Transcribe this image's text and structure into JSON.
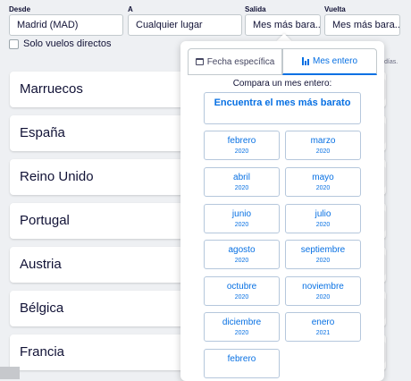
{
  "search": {
    "from_label": "Desde",
    "from_value": "Madrid (MAD)",
    "to_label": "A",
    "to_value": "Cualquier lugar",
    "depart_label": "Salida",
    "depart_value": "Mes más bara...",
    "return_label": "Vuelta",
    "return_value": "Mes más bara...",
    "direct_only_label": "Solo vuelos directos",
    "direct_only_checked": false
  },
  "side_note": "días.",
  "countries": [
    "Marruecos",
    "España",
    "Reino Unido",
    "Portugal",
    "Austria",
    "Bélgica",
    "Francia"
  ],
  "popup": {
    "tabs": [
      {
        "label": "Fecha específica",
        "icon": "calendar-icon",
        "active": false
      },
      {
        "label": "Mes entero",
        "icon": "bar-chart-icon",
        "active": true
      }
    ],
    "compare_text": "Compara un mes entero:",
    "cheapest_button": "Encuentra el mes más barato",
    "months": [
      {
        "name": "febrero",
        "year": "2020"
      },
      {
        "name": "marzo",
        "year": "2020"
      },
      {
        "name": "abril",
        "year": "2020"
      },
      {
        "name": "mayo",
        "year": "2020"
      },
      {
        "name": "junio",
        "year": "2020"
      },
      {
        "name": "julio",
        "year": "2020"
      },
      {
        "name": "agosto",
        "year": "2020"
      },
      {
        "name": "septiembre",
        "year": "2020"
      },
      {
        "name": "octubre",
        "year": "2020"
      },
      {
        "name": "noviembre",
        "year": "2020"
      },
      {
        "name": "diciembre",
        "year": "2020"
      },
      {
        "name": "enero",
        "year": "2021"
      },
      {
        "name": "febrero",
        "year": ""
      }
    ]
  },
  "colors": {
    "accent": "#0770e3",
    "text": "#111236",
    "border": "#c2c9cd",
    "page_bg": "#eef0f3"
  }
}
